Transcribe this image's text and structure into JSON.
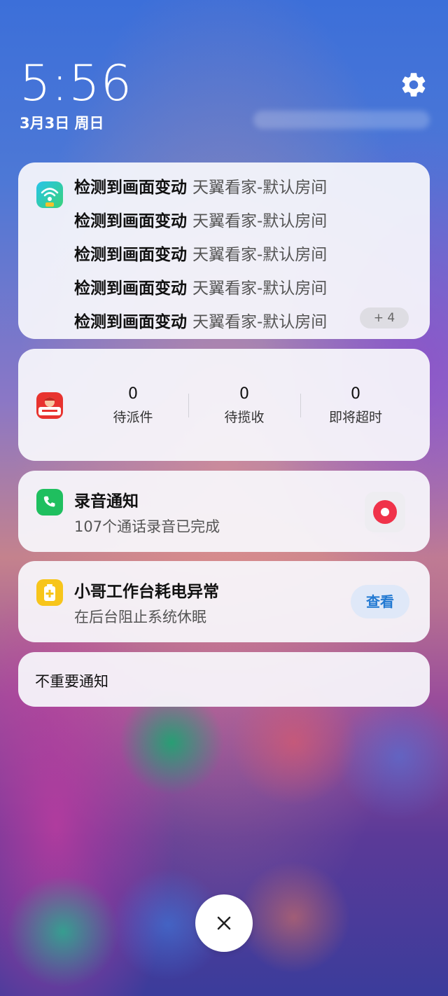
{
  "lockscreen": {
    "time": "5:56",
    "date": "3月3日 周日"
  },
  "icons": {
    "settings": "gear-icon",
    "close": "close-icon"
  },
  "notifications": {
    "camera": {
      "app_icon": "tianyi-camera-icon",
      "items": [
        {
          "title": "检测到画面变动",
          "source": "天翼看家-默认房间"
        },
        {
          "title": "检测到画面变动",
          "source": "天翼看家-默认房间"
        },
        {
          "title": "检测到画面变动",
          "source": "天翼看家-默认房间"
        },
        {
          "title": "检测到画面变动",
          "source": "天翼看家-默认房间"
        },
        {
          "title": "检测到画面变动",
          "source": "天翼看家-默认房间"
        }
      ],
      "more_count": "+ 4"
    },
    "courier": {
      "app_icon": "courier-app-icon",
      "stats": [
        {
          "value": "0",
          "label": "待派件"
        },
        {
          "value": "0",
          "label": "待揽收"
        },
        {
          "value": "0",
          "label": "即将超时"
        }
      ]
    },
    "recording": {
      "app_icon": "phone-icon",
      "title": "录音通知",
      "subtitle": "107个通话录音已完成",
      "action_icon": "record-icon"
    },
    "battery": {
      "app_icon": "battery-warning-icon",
      "title": "小哥工作台耗电异常",
      "subtitle": "在后台阻止系统休眠",
      "action_label": "查看"
    },
    "unimportant": {
      "label": "不重要通知"
    }
  },
  "colors": {
    "accent_blue": "#2279d2",
    "record_red": "#f0334a",
    "phone_green": "#1fbf5f",
    "battery_yellow": "#f7c51b"
  }
}
